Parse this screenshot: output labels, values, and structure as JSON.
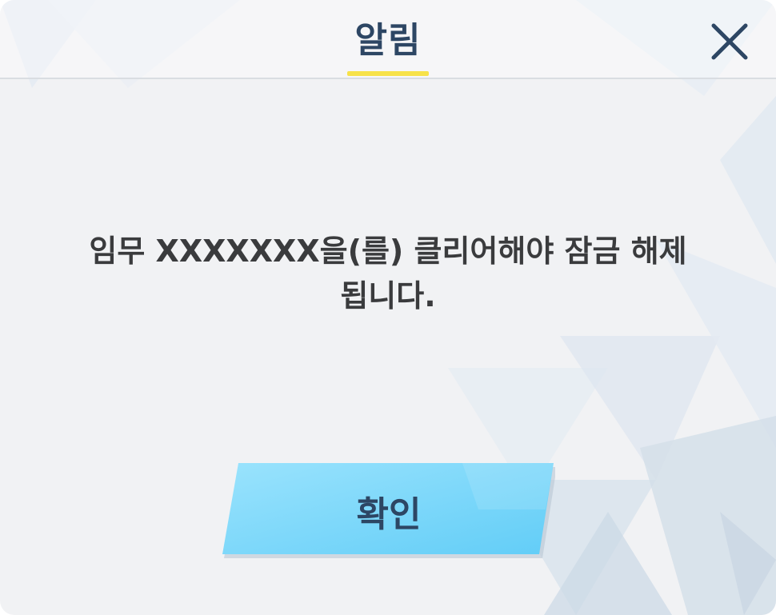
{
  "dialog": {
    "title": "알림",
    "close_icon": "close-icon",
    "message_line1": "임무 XXXXXXX을(를) 클리어해야 잠금 해제",
    "message_line2": "됩니다.",
    "confirm_label": "확인"
  },
  "colors": {
    "title_text": "#2d4664",
    "underline_accent": "#f7e24a",
    "button_fill": "#7fd9fb",
    "body_text": "#3a3b3d",
    "background": "#f1f2f4"
  }
}
